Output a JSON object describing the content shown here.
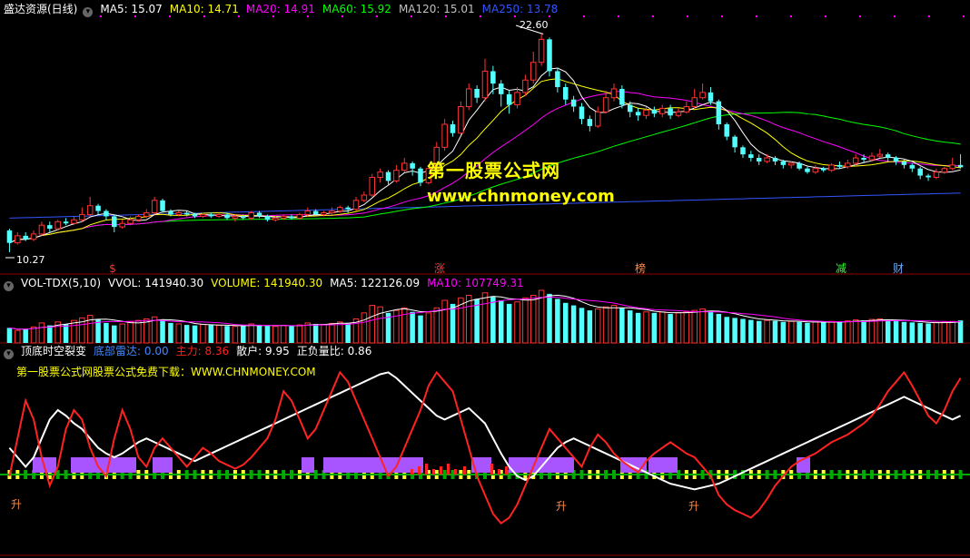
{
  "price_header": {
    "title": "盛达资源(日线)",
    "ma": [
      {
        "label": "MA5: 15.07",
        "color": "#ffffff"
      },
      {
        "label": "MA10: 14.71",
        "color": "#ffff00"
      },
      {
        "label": "MA20: 14.91",
        "color": "#ff00ff"
      },
      {
        "label": "MA60: 15.92",
        "color": "#00ff00"
      },
      {
        "label": "MA120: 15.01",
        "color": "#c0c0c0"
      },
      {
        "label": "MA250: 13.78",
        "color": "#3355ff"
      }
    ]
  },
  "price_labels": {
    "high": "22.60",
    "low": "10.27"
  },
  "markers": [
    {
      "text": "$",
      "color": "#ff3333"
    },
    {
      "text": "涨",
      "color": "#ff3333"
    },
    {
      "text": "榜",
      "color": "#ff8844"
    },
    {
      "text": "减",
      "color": "#33ff33"
    },
    {
      "text": "财",
      "color": "#66aaff"
    }
  ],
  "watermark": {
    "line1": "第一股票公式网",
    "line2": "www.chnmoney.com"
  },
  "vol_header": {
    "title": "VOL-TDX(5,10)",
    "items": [
      {
        "label": "VVOL: 141940.30",
        "color": "#ffffff"
      },
      {
        "label": "VOLUME: 141940.30",
        "color": "#ffff00"
      },
      {
        "label": "MA5: 122126.09",
        "color": "#ffffff"
      },
      {
        "label": "MA10: 107749.31",
        "color": "#ff00ff"
      }
    ]
  },
  "ind_header": {
    "title": "顶底时空裂变",
    "items": [
      {
        "label": "底部雷达: 0.00",
        "color": "#4488ff"
      },
      {
        "label": "主力: 8.36",
        "color": "#ff2222"
      },
      {
        "label": "散户: 9.95",
        "color": "#ffffff"
      },
      {
        "label": "正负量比: 0.86",
        "color": "#ffffff"
      }
    ]
  },
  "ind_note": "第一股票公式网股票公式免费下载：WWW.CHNMONEY.COM",
  "ind_signals": {
    "rise": "升"
  },
  "colors": {
    "up": "#ff3333",
    "down": "#54ffff",
    "ma5": "#ffffff",
    "ma10": "#ffff00",
    "ma20": "#ff00ff",
    "ma60": "#00ff00",
    "ma250": "#3355ff",
    "purple": "#a855ff"
  },
  "chart_data": {
    "type": "candlestick",
    "price_range": [
      10.27,
      22.6
    ],
    "price_axis_max": 23.6,
    "candles": [
      [
        11.5,
        10.8,
        11.6,
        10.27
      ],
      [
        10.8,
        11.2,
        11.4,
        10.7
      ],
      [
        11.2,
        11.0,
        11.4,
        10.9
      ],
      [
        11.0,
        11.3,
        11.5,
        10.9
      ],
      [
        11.3,
        11.8,
        12.0,
        11.2
      ],
      [
        11.8,
        11.6,
        12.0,
        11.4
      ],
      [
        11.6,
        12.0,
        12.1,
        11.5
      ],
      [
        12.0,
        11.9,
        12.2,
        11.8
      ],
      [
        11.9,
        12.1,
        12.3,
        11.8
      ],
      [
        12.1,
        12.4,
        12.8,
        12.0
      ],
      [
        12.4,
        12.9,
        13.4,
        12.3
      ],
      [
        12.9,
        12.6,
        13.0,
        12.4
      ],
      [
        12.6,
        12.3,
        12.7,
        12.1
      ],
      [
        12.3,
        11.7,
        12.4,
        11.4
      ],
      [
        11.7,
        11.9,
        12.1,
        11.6
      ],
      [
        11.9,
        12.1,
        12.3,
        11.8
      ],
      [
        12.1,
        12.3,
        12.4,
        12.0
      ],
      [
        12.3,
        12.5,
        12.7,
        12.2
      ],
      [
        12.5,
        13.2,
        13.4,
        12.4
      ],
      [
        13.2,
        12.6,
        13.3,
        12.5
      ],
      [
        12.6,
        12.4,
        12.7,
        12.3
      ],
      [
        12.4,
        12.5,
        12.6,
        12.3
      ],
      [
        12.5,
        12.4,
        12.6,
        12.3
      ],
      [
        12.4,
        12.3,
        12.5,
        12.2
      ],
      [
        12.3,
        12.4,
        12.5,
        12.2
      ],
      [
        12.4,
        12.3,
        12.5,
        12.2
      ],
      [
        12.3,
        12.4,
        12.5,
        12.2
      ],
      [
        12.4,
        12.2,
        12.5,
        12.1
      ],
      [
        12.2,
        12.3,
        12.4,
        12.0
      ],
      [
        12.3,
        12.2,
        12.4,
        12.1
      ],
      [
        12.2,
        12.5,
        12.6,
        12.1
      ],
      [
        12.5,
        12.3,
        12.6,
        12.2
      ],
      [
        12.3,
        12.1,
        12.4,
        12.0
      ],
      [
        12.1,
        12.2,
        12.3,
        12.0
      ],
      [
        12.2,
        12.3,
        12.4,
        12.1
      ],
      [
        12.3,
        12.2,
        12.4,
        12.1
      ],
      [
        12.2,
        12.4,
        12.5,
        12.1
      ],
      [
        12.4,
        12.6,
        12.8,
        12.3
      ],
      [
        12.6,
        12.4,
        12.7,
        12.3
      ],
      [
        12.4,
        12.5,
        12.6,
        12.3
      ],
      [
        12.5,
        12.6,
        12.8,
        12.4
      ],
      [
        12.6,
        12.8,
        12.9,
        12.5
      ],
      [
        12.8,
        12.7,
        12.9,
        12.5
      ],
      [
        12.7,
        13.2,
        13.4,
        12.6
      ],
      [
        13.2,
        13.5,
        13.7,
        13.1
      ],
      [
        13.5,
        14.5,
        14.7,
        13.4
      ],
      [
        14.5,
        14.8,
        15.0,
        14.2
      ],
      [
        14.8,
        14.3,
        14.9,
        14.1
      ],
      [
        14.3,
        14.9,
        15.2,
        14.2
      ],
      [
        14.9,
        15.3,
        15.6,
        14.8
      ],
      [
        15.3,
        15.0,
        15.4,
        14.6
      ],
      [
        15.0,
        14.2,
        15.1,
        14.0
      ],
      [
        14.2,
        15.0,
        15.2,
        14.1
      ],
      [
        15.0,
        16.2,
        16.5,
        14.9
      ],
      [
        16.2,
        17.5,
        17.8,
        16.0
      ],
      [
        17.5,
        17.0,
        17.7,
        16.8
      ],
      [
        17.0,
        18.5,
        18.8,
        16.9
      ],
      [
        18.5,
        19.5,
        19.8,
        18.3
      ],
      [
        19.5,
        19.0,
        19.7,
        18.7
      ],
      [
        19.0,
        20.5,
        21.2,
        18.8
      ],
      [
        20.5,
        19.8,
        20.8,
        19.2
      ],
      [
        19.8,
        19.2,
        20.0,
        18.5
      ],
      [
        19.2,
        18.6,
        19.4,
        18.1
      ],
      [
        18.6,
        19.3,
        19.6,
        18.4
      ],
      [
        19.3,
        20.0,
        20.3,
        19.1
      ],
      [
        20.0,
        21.0,
        21.6,
        19.8
      ],
      [
        21.0,
        22.3,
        22.6,
        20.8
      ],
      [
        22.3,
        20.5,
        22.4,
        20.2
      ],
      [
        20.5,
        19.6,
        20.7,
        19.3
      ],
      [
        19.6,
        18.9,
        19.8,
        18.6
      ],
      [
        18.9,
        18.5,
        19.1,
        18.2
      ],
      [
        18.5,
        17.8,
        18.7,
        17.5
      ],
      [
        17.8,
        17.4,
        18.0,
        17.1
      ],
      [
        17.4,
        18.2,
        18.5,
        17.3
      ],
      [
        18.2,
        19.0,
        19.4,
        18.1
      ],
      [
        19.0,
        19.5,
        19.8,
        18.8
      ],
      [
        19.5,
        18.6,
        19.7,
        18.4
      ],
      [
        18.6,
        18.2,
        18.8,
        17.9
      ],
      [
        18.2,
        18.0,
        18.4,
        17.7
      ],
      [
        18.0,
        18.3,
        18.5,
        17.8
      ],
      [
        18.3,
        18.1,
        18.5,
        17.9
      ],
      [
        18.1,
        18.4,
        18.6,
        17.9
      ],
      [
        18.4,
        18.0,
        18.6,
        17.8
      ],
      [
        18.0,
        18.2,
        18.4,
        17.9
      ],
      [
        18.2,
        18.5,
        18.8,
        18.1
      ],
      [
        18.5,
        19.0,
        19.5,
        18.4
      ],
      [
        19.0,
        19.3,
        19.8,
        18.9
      ],
      [
        19.3,
        18.8,
        19.6,
        18.6
      ],
      [
        18.8,
        17.5,
        18.9,
        17.2
      ],
      [
        17.5,
        16.8,
        17.6,
        16.6
      ],
      [
        16.8,
        16.2,
        16.9,
        15.9
      ],
      [
        16.2,
        15.8,
        16.3,
        15.6
      ],
      [
        15.8,
        15.6,
        16.0,
        15.4
      ],
      [
        15.6,
        15.4,
        15.8,
        15.2
      ],
      [
        15.4,
        15.6,
        15.8,
        15.3
      ],
      [
        15.6,
        15.4,
        15.7,
        15.2
      ],
      [
        15.4,
        15.2,
        15.5,
        15.0
      ],
      [
        15.2,
        15.3,
        15.4,
        15.0
      ],
      [
        15.3,
        15.0,
        15.4,
        14.9
      ],
      [
        15.0,
        14.8,
        15.1,
        14.7
      ],
      [
        14.8,
        15.0,
        15.2,
        14.7
      ],
      [
        15.0,
        14.9,
        15.1,
        14.8
      ],
      [
        14.9,
        15.2,
        15.3,
        14.8
      ],
      [
        15.2,
        15.1,
        15.4,
        15.0
      ],
      [
        15.1,
        15.3,
        15.5,
        15.0
      ],
      [
        15.3,
        15.6,
        15.8,
        15.2
      ],
      [
        15.6,
        15.5,
        15.8,
        15.3
      ],
      [
        15.5,
        15.7,
        15.9,
        15.4
      ],
      [
        15.7,
        15.8,
        16.1,
        15.6
      ],
      [
        15.8,
        15.6,
        15.9,
        15.4
      ],
      [
        15.6,
        15.4,
        15.7,
        15.2
      ],
      [
        15.4,
        15.2,
        15.5,
        15.0
      ],
      [
        15.2,
        15.0,
        15.3,
        14.8
      ],
      [
        15.0,
        14.6,
        15.1,
        14.4
      ],
      [
        14.6,
        14.5,
        14.7,
        14.3
      ],
      [
        14.5,
        14.8,
        15.0,
        14.4
      ],
      [
        14.8,
        15.0,
        15.1,
        14.7
      ],
      [
        15.0,
        15.2,
        15.6,
        14.9
      ],
      [
        15.2,
        15.07,
        15.8,
        15.0
      ]
    ],
    "volumes": [
      30,
      25,
      28,
      32,
      40,
      35,
      42,
      38,
      45,
      50,
      55,
      48,
      40,
      35,
      38,
      42,
      45,
      48,
      52,
      46,
      40,
      38,
      36,
      35,
      37,
      36,
      35,
      34,
      33,
      34,
      38,
      36,
      34,
      33,
      35,
      34,
      36,
      40,
      38,
      37,
      39,
      42,
      40,
      48,
      60,
      75,
      72,
      60,
      65,
      70,
      62,
      55,
      60,
      70,
      85,
      78,
      90,
      95,
      88,
      100,
      92,
      85,
      78,
      82,
      90,
      95,
      105,
      98,
      88,
      80,
      75,
      70,
      65,
      68,
      72,
      75,
      70,
      65,
      60,
      62,
      60,
      62,
      58,
      60,
      62,
      65,
      68,
      64,
      58,
      52,
      50,
      48,
      46,
      44,
      45,
      44,
      42,
      43,
      42,
      40,
      42,
      41,
      43,
      42,
      44,
      46,
      45,
      47,
      48,
      46,
      44,
      42,
      41,
      40,
      39,
      41,
      42,
      43,
      45
    ],
    "indicator_red": [
      40,
      60,
      80,
      70,
      50,
      35,
      45,
      65,
      75,
      70,
      55,
      45,
      40,
      60,
      75,
      65,
      50,
      45,
      55,
      60,
      55,
      50,
      45,
      50,
      55,
      52,
      48,
      46,
      44,
      46,
      50,
      55,
      60,
      70,
      85,
      80,
      70,
      60,
      65,
      75,
      85,
      95,
      90,
      80,
      70,
      60,
      50,
      40,
      45,
      55,
      65,
      75,
      88,
      95,
      90,
      85,
      70,
      55,
      40,
      30,
      20,
      15,
      18,
      25,
      35,
      45,
      55,
      65,
      60,
      55,
      50,
      45,
      55,
      62,
      58,
      52,
      48,
      45,
      42,
      48,
      52,
      55,
      58,
      55,
      52,
      50,
      45,
      40,
      30,
      25,
      22,
      20,
      18,
      22,
      28,
      35,
      40,
      45,
      48,
      50,
      52,
      55,
      58,
      60,
      62,
      65,
      68,
      72,
      78,
      85,
      90,
      95,
      88,
      80,
      72,
      68,
      75,
      85,
      92
    ],
    "indicator_white": [
      55,
      50,
      45,
      50,
      60,
      70,
      75,
      72,
      68,
      65,
      60,
      55,
      52,
      50,
      52,
      55,
      58,
      60,
      58,
      56,
      54,
      52,
      50,
      48,
      50,
      52,
      54,
      56,
      58,
      60,
      62,
      64,
      66,
      68,
      70,
      72,
      74,
      76,
      78,
      80,
      82,
      84,
      86,
      88,
      90,
      92,
      94,
      95,
      92,
      88,
      84,
      80,
      76,
      72,
      70,
      72,
      74,
      76,
      72,
      68,
      60,
      52,
      45,
      40,
      38,
      40,
      45,
      50,
      55,
      58,
      60,
      58,
      56,
      54,
      52,
      50,
      48,
      46,
      44,
      42,
      40,
      38,
      36,
      35,
      34,
      33,
      34,
      35,
      36,
      38,
      40,
      42,
      44,
      46,
      48,
      50,
      52,
      54,
      56,
      58,
      60,
      62,
      64,
      66,
      68,
      70,
      72,
      74,
      76,
      78,
      80,
      82,
      80,
      78,
      76,
      74,
      72,
      70,
      72
    ]
  }
}
